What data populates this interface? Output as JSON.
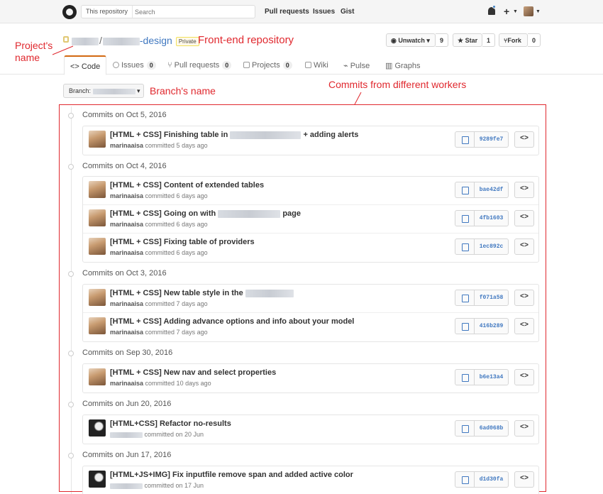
{
  "header": {
    "search_scope": "This repository",
    "search_placeholder": "Search",
    "nav": [
      "Pull requests",
      "Issues",
      "Gist"
    ],
    "plus_icon": "+"
  },
  "repo": {
    "name_suffix": "-design",
    "separator": "/",
    "visibility": "Private",
    "watch": {
      "label": "Unwatch",
      "count": "9"
    },
    "star": {
      "label": "Star",
      "count": "1"
    },
    "fork": {
      "label": "Fork",
      "count": "0"
    }
  },
  "annotations": {
    "project_name": "Project's\nname",
    "front_end": "Front-end repository",
    "branch_name": "Branch's name",
    "commits": "Commits from different workers"
  },
  "tabs": [
    {
      "label": "Code",
      "count": null,
      "icon": "code-icon"
    },
    {
      "label": "Issues",
      "count": "0",
      "icon": "issue-icon"
    },
    {
      "label": "Pull requests",
      "count": "0",
      "icon": "pr-icon"
    },
    {
      "label": "Projects",
      "count": "0",
      "icon": "project-icon"
    },
    {
      "label": "Wiki",
      "count": null,
      "icon": "book-icon"
    },
    {
      "label": "Pulse",
      "count": null,
      "icon": "pulse-icon"
    },
    {
      "label": "Graphs",
      "count": null,
      "icon": "graph-icon"
    }
  ],
  "branch": {
    "label": "Branch:"
  },
  "commit_groups": [
    {
      "date": "Commits on Oct 5, 2016",
      "commits": [
        {
          "title_a": "[HTML + CSS] Finishing table in",
          "title_b": "+ adding alerts",
          "author": "marinaaisa",
          "meta": "committed 5 days ago",
          "sha": "9289fe7",
          "avatar": "photo"
        }
      ]
    },
    {
      "date": "Commits on Oct 4, 2016",
      "commits": [
        {
          "title_a": "[HTML + CSS] Content of extended tables",
          "title_b": "",
          "author": "marinaaisa",
          "meta": "committed 6 days ago",
          "sha": "bae42df",
          "avatar": "photo"
        },
        {
          "title_a": "[HTML + CSS] Going on with",
          "title_b": "page",
          "author": "marinaaisa",
          "meta": "committed 6 days ago",
          "sha": "4fb1603",
          "avatar": "photo"
        },
        {
          "title_a": "[HTML + CSS] Fixing table of providers",
          "title_b": "",
          "author": "marinaaisa",
          "meta": "committed 6 days ago",
          "sha": "1ec892c",
          "avatar": "photo"
        }
      ]
    },
    {
      "date": "Commits on Oct 3, 2016",
      "commits": [
        {
          "title_a": "[HTML + CSS] New table style in the",
          "title_b": "",
          "author": "marinaaisa",
          "meta": "committed 7 days ago",
          "sha": "f071a58",
          "avatar": "photo"
        },
        {
          "title_a": "[HTML + CSS] Adding advance options and info about your model",
          "title_b": "",
          "author": "marinaaisa",
          "meta": "committed 7 days ago",
          "sha": "416b289",
          "avatar": "photo"
        }
      ]
    },
    {
      "date": "Commits on Sep 30, 2016",
      "commits": [
        {
          "title_a": "[HTML + CSS] New nav and select properties",
          "title_b": "",
          "author": "marinaaisa",
          "meta": "committed 10 days ago",
          "sha": "b6e13a4",
          "avatar": "photo"
        }
      ]
    },
    {
      "date": "Commits on Jun 20, 2016",
      "commits": [
        {
          "title_a": "[HTML+CSS] Refactor no-results",
          "title_b": "",
          "author": "",
          "meta": "committed on 20 Jun",
          "sha": "6ad068b",
          "avatar": "dark"
        }
      ]
    },
    {
      "date": "Commits on Jun 17, 2016",
      "commits": [
        {
          "title_a": "[HTML+JS+IMG] Fix inputfile remove span and added active color",
          "title_b": "",
          "author": "",
          "meta": "committed on 17 Jun",
          "sha": "d1d30fa",
          "avatar": "dark"
        }
      ]
    }
  ],
  "colors": {
    "annotation": "#e0282e",
    "link": "#4078c0",
    "tab_accent": "#d26911"
  }
}
